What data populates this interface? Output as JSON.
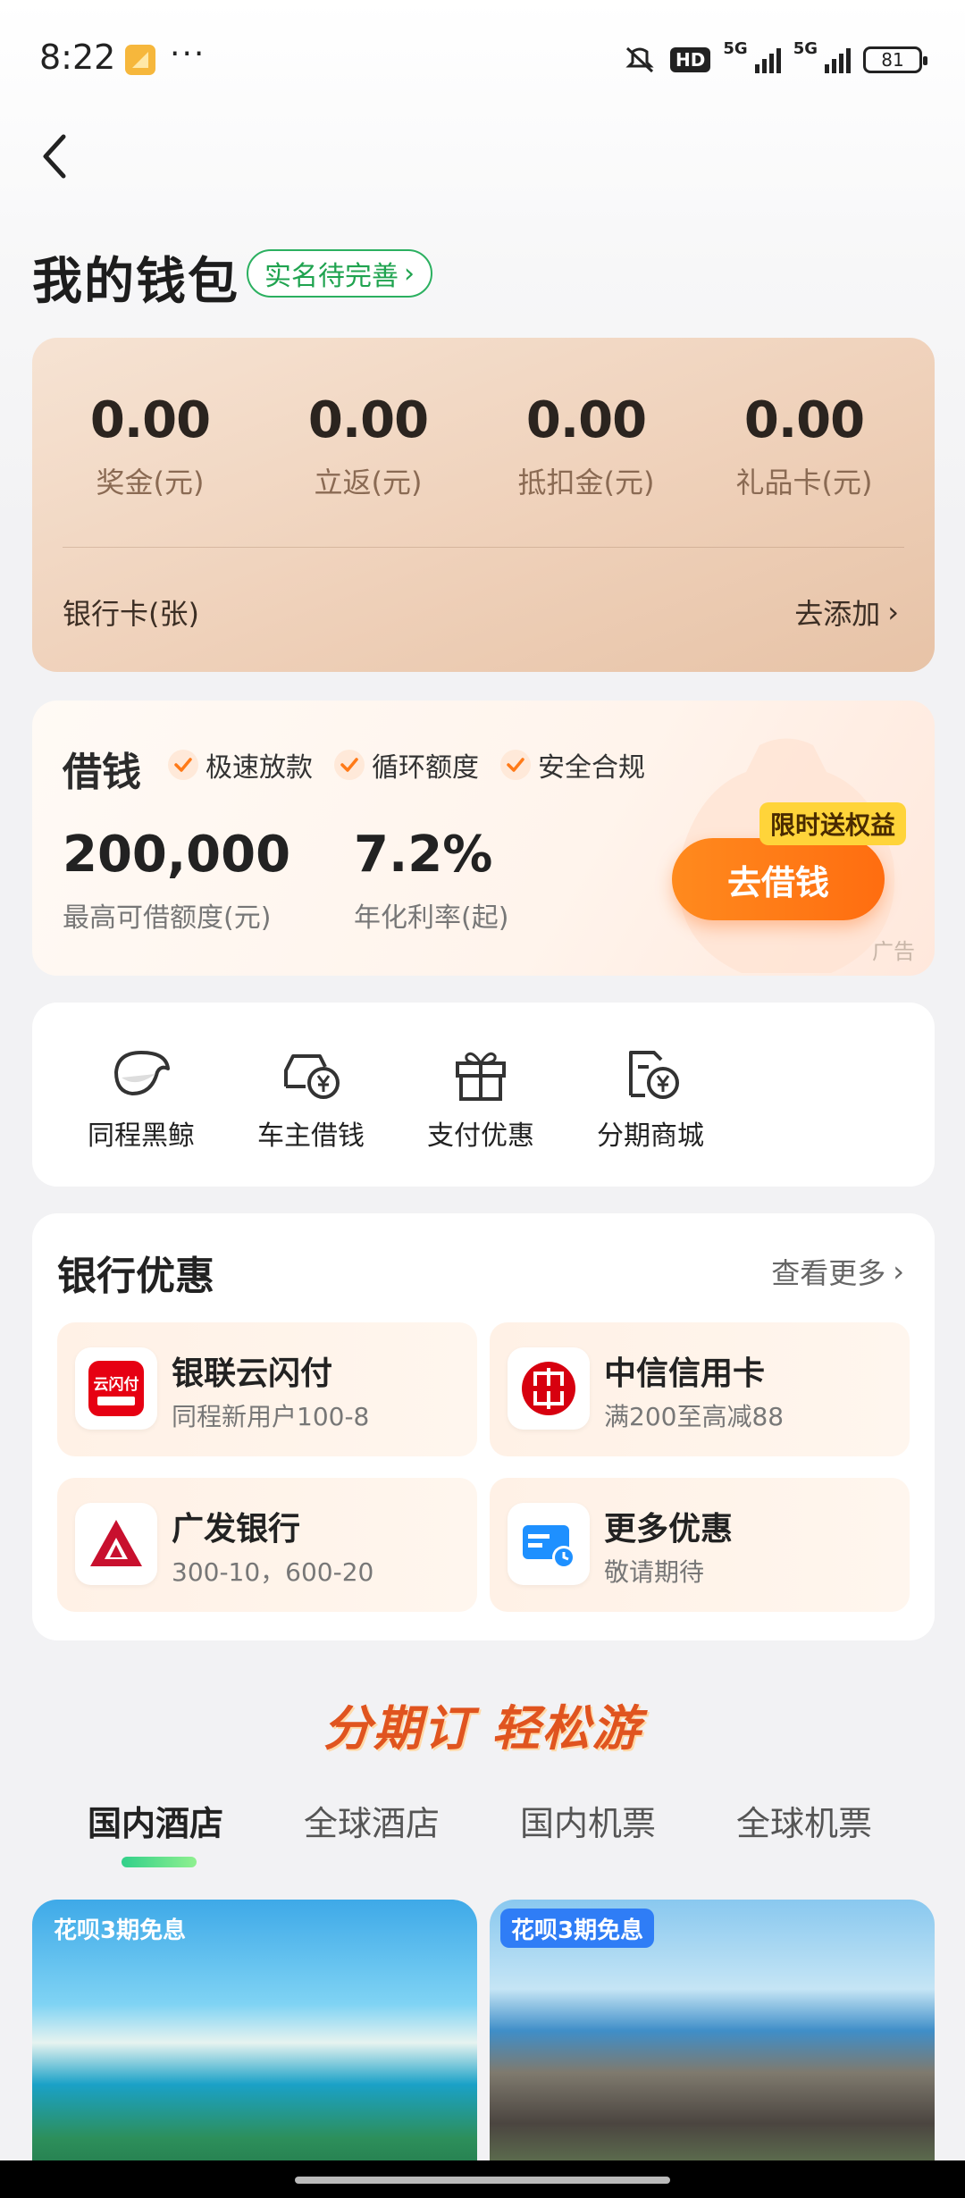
{
  "status_bar": {
    "time": "8:22",
    "more": "···",
    "hd": "HD",
    "net1": "5G",
    "net2": "5G",
    "battery": "81"
  },
  "header": {
    "title": "我的钱包",
    "name_badge": "实名待完善",
    "name_badge_arrow": "›"
  },
  "wallet": {
    "stats": [
      {
        "value": "0.00",
        "label": "奖金(元)"
      },
      {
        "value": "0.00",
        "label": "立返(元)"
      },
      {
        "value": "0.00",
        "label": "抵扣金(元)"
      },
      {
        "value": "0.00",
        "label": "礼品卡(元)"
      }
    ],
    "bank_label": "银行卡(张)",
    "add_label": "去添加",
    "arrow": "›"
  },
  "loan": {
    "title": "借钱",
    "features": [
      "极速放款",
      "循环额度",
      "安全合规"
    ],
    "amount": "200,000",
    "amount_label": "最高可借额度(元)",
    "rate": "7.2%",
    "rate_label": "年化利率(起)",
    "button": "去借钱",
    "tag": "限时送权益",
    "ad": "广告"
  },
  "services": [
    {
      "label": "同程黑鲸",
      "icon": "whale-icon"
    },
    {
      "label": "车主借钱",
      "icon": "car-yuan-icon"
    },
    {
      "label": "支付优惠",
      "icon": "gift-icon"
    },
    {
      "label": "分期商城",
      "icon": "installment-mall-icon"
    }
  ],
  "bank_offers": {
    "title": "银行优惠",
    "more": "查看更多",
    "more_arrow": "›",
    "items": [
      {
        "name": "银联云闪付",
        "desc": "同程新用户100-8",
        "logo": "unionpay-quickpass-logo",
        "logo_text": "云闪付"
      },
      {
        "name": "中信信用卡",
        "desc": "满200至高减88",
        "logo": "citic-logo"
      },
      {
        "name": "广发银行",
        "desc": "300-10，600-20",
        "logo": "cgb-logo"
      },
      {
        "name": "更多优惠",
        "desc": "敬请期待",
        "logo": "card-clock-icon"
      }
    ]
  },
  "promo": {
    "title": "分期订 轻松游",
    "tabs": [
      "国内酒店",
      "全球酒店",
      "国内机票",
      "全球机票"
    ],
    "active_tab": 0,
    "hotels": [
      {
        "tag": "花呗3期免息"
      },
      {
        "tag": "花呗3期免息"
      }
    ]
  },
  "colors": {
    "accent_green": "#1fa34f",
    "loan_button": "#ff7a18",
    "tag_yellow": "#ffd43a",
    "hotel_tag_blue": "#2f7df6"
  }
}
